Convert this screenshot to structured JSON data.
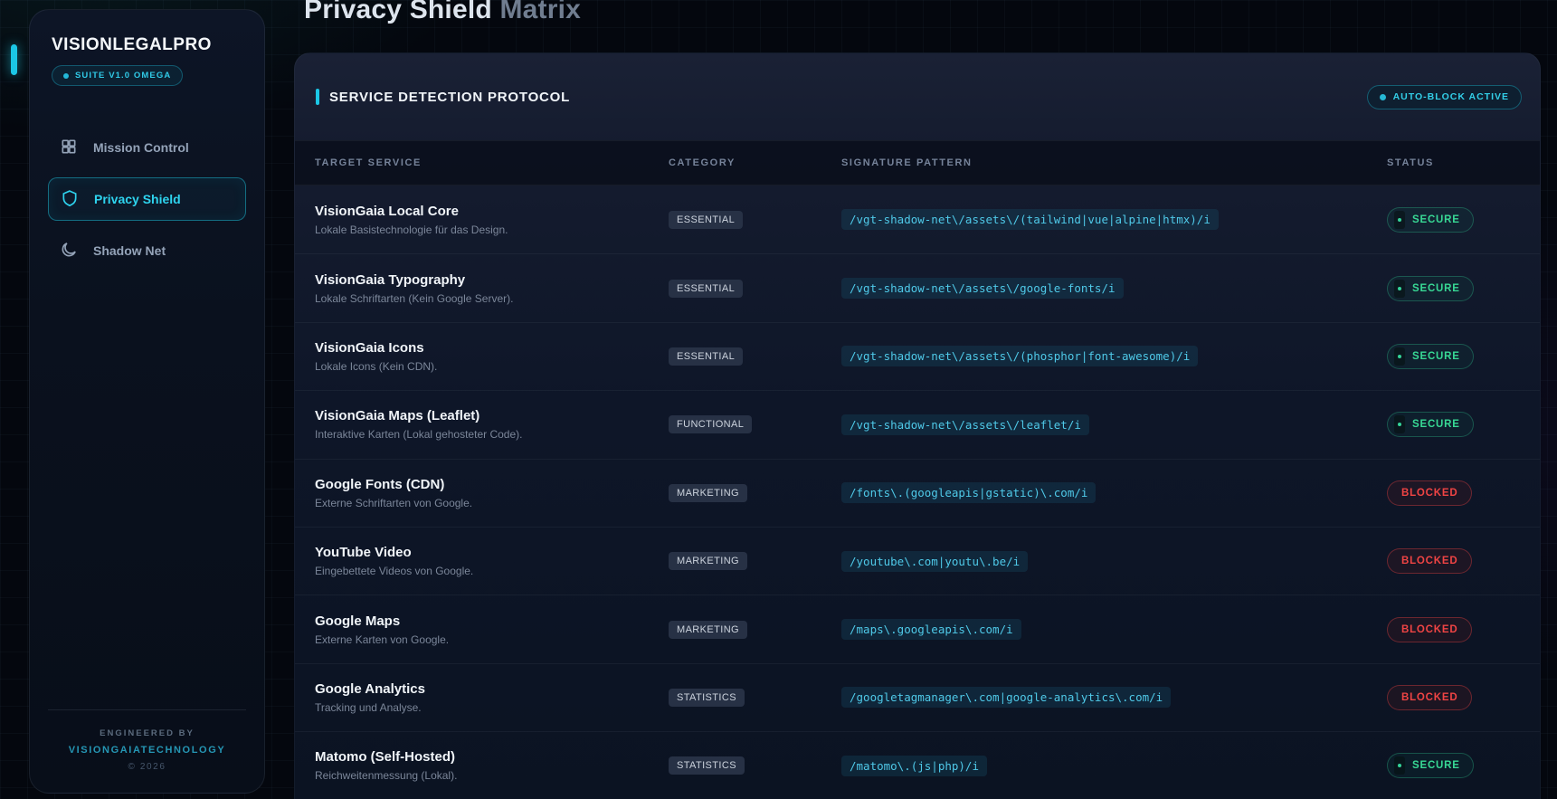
{
  "page_title": {
    "primary": "Privacy Shield",
    "secondary": "Matrix"
  },
  "colors": {
    "accent_cyan": "#1bc7e6",
    "secure_green": "#34d399",
    "blocked_red": "#ef4444",
    "brand_text": "#f4f7fa"
  },
  "sidebar": {
    "brand": "VISIONLEGALPRO",
    "version_badge": "SUITE V1.0 OMEGA",
    "nav": [
      {
        "label": "Mission Control",
        "icon": "grid-icon",
        "active": false
      },
      {
        "label": "Privacy Shield",
        "icon": "shield-icon",
        "active": true
      },
      {
        "label": "Shadow Net",
        "icon": "moon-icon",
        "active": false
      }
    ],
    "footer": {
      "line1": "ENGINEERED BY",
      "line2": "VISIONGAIATECHNOLOGY",
      "line3": "© 2026"
    }
  },
  "panel": {
    "title": "SERVICE DETECTION PROTOCOL",
    "badge": "AUTO-BLOCK ACTIVE",
    "columns": [
      "TARGET SERVICE",
      "CATEGORY",
      "SIGNATURE PATTERN",
      "STATUS"
    ],
    "rows": [
      {
        "name": "VisionGaia Local Core",
        "desc": "Lokale Basistechnologie für das Design.",
        "category": "ESSENTIAL",
        "pattern": "/vgt-shadow-net\\/assets\\/(tailwind|vue|alpine|htmx)/i",
        "status": "SECURE"
      },
      {
        "name": "VisionGaia Typography",
        "desc": "Lokale Schriftarten (Kein Google Server).",
        "category": "ESSENTIAL",
        "pattern": "/vgt-shadow-net\\/assets\\/google-fonts/i",
        "status": "SECURE"
      },
      {
        "name": "VisionGaia Icons",
        "desc": "Lokale Icons (Kein CDN).",
        "category": "ESSENTIAL",
        "pattern": "/vgt-shadow-net\\/assets\\/(phosphor|font-awesome)/i",
        "status": "SECURE"
      },
      {
        "name": "VisionGaia Maps (Leaflet)",
        "desc": "Interaktive Karten (Lokal gehosteter Code).",
        "category": "FUNCTIONAL",
        "pattern": "/vgt-shadow-net\\/assets\\/leaflet/i",
        "status": "SECURE"
      },
      {
        "name": "Google Fonts (CDN)",
        "desc": "Externe Schriftarten von Google.",
        "category": "MARKETING",
        "pattern": "/fonts\\.(googleapis|gstatic)\\.com/i",
        "status": "BLOCKED"
      },
      {
        "name": "YouTube Video",
        "desc": "Eingebettete Videos von Google.",
        "category": "MARKETING",
        "pattern": "/youtube\\.com|youtu\\.be/i",
        "status": "BLOCKED"
      },
      {
        "name": "Google Maps",
        "desc": "Externe Karten von Google.",
        "category": "MARKETING",
        "pattern": "/maps\\.googleapis\\.com/i",
        "status": "BLOCKED"
      },
      {
        "name": "Google Analytics",
        "desc": "Tracking und Analyse.",
        "category": "STATISTICS",
        "pattern": "/googletagmanager\\.com|google-analytics\\.com/i",
        "status": "BLOCKED"
      },
      {
        "name": "Matomo (Self-Hosted)",
        "desc": "Reichweitenmessung (Lokal).",
        "category": "STATISTICS",
        "pattern": "/matomo\\.(js|php)/i",
        "status": "SECURE"
      }
    ]
  }
}
